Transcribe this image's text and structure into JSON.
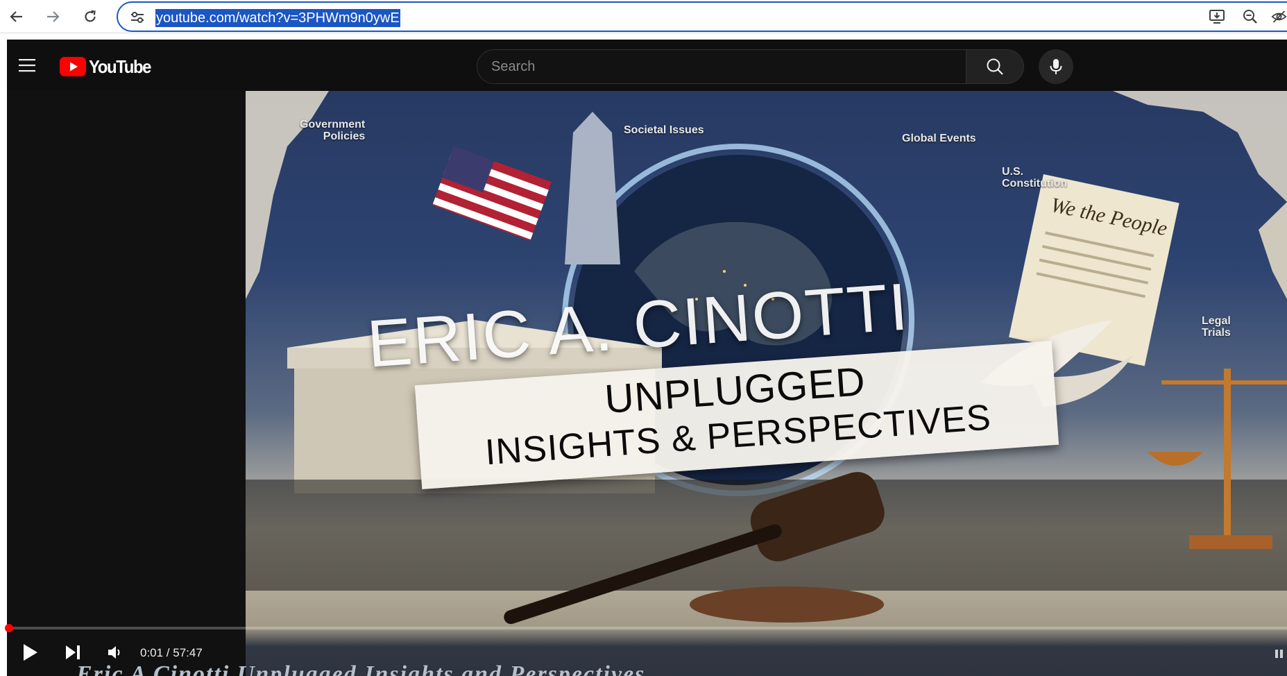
{
  "browser": {
    "url": "youtube.com/watch?v=3PHWm9n0ywE",
    "icons": [
      "back-icon",
      "forward-icon",
      "reload-icon",
      "site-info-icon",
      "install-app-icon",
      "zoom-icon",
      "eye-off-icon"
    ]
  },
  "youtube": {
    "logo_text": "YouTube",
    "search_placeholder": "Search",
    "icons": [
      "menu-icon",
      "search-icon",
      "microphone-icon"
    ],
    "brand_red": "#ff0000"
  },
  "video": {
    "title_overlay": "ERIC A. CINOTTI",
    "banner_line1": "UNPLUGGED",
    "banner_line2": "INSIGHTS & PERSPECTIVES",
    "caption": "Eric A Cinotti Unplugged Insights and Perspectives",
    "tags": {
      "government_policies": "Government\nPolicies",
      "societal_issues": "Societal Issues",
      "global_events": "Global Events",
      "us_constitution": "U.S.\nConstitution",
      "legal_trials": "Legal\nTrials"
    },
    "document_script": "We the People"
  },
  "player": {
    "current_time": "0:01",
    "duration": "57:47",
    "time_display": "0:01 / 57:47",
    "progress_fraction": 0.0003,
    "controls": [
      "play-icon",
      "next-icon",
      "volume-icon"
    ]
  }
}
